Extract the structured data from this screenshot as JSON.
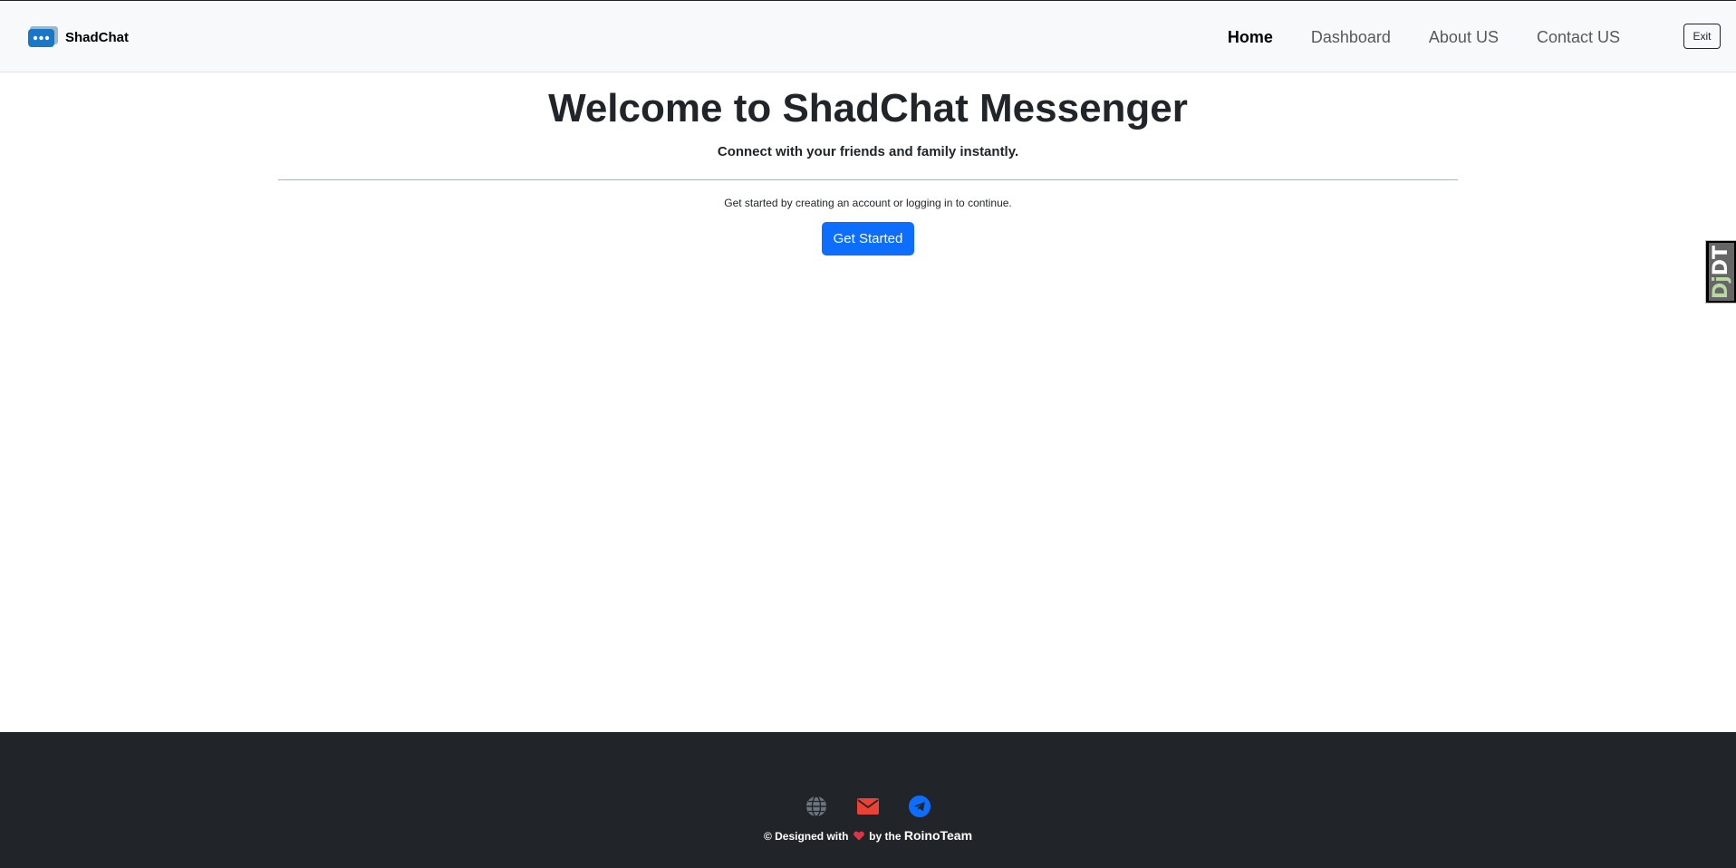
{
  "navbar": {
    "brand": {
      "name": "ShadChat",
      "logo_icon": "chat-bubble-icon"
    },
    "links": [
      {
        "label": "Home",
        "active": true
      },
      {
        "label": "Dashboard",
        "active": false
      },
      {
        "label": "About US",
        "active": false
      },
      {
        "label": "Contact US",
        "active": false
      }
    ],
    "exit_label": "Exit"
  },
  "hero": {
    "title": "Welcome to ShadChat Messenger",
    "subtitle": "Connect with your friends and family instantly.",
    "text": "Get started by creating an account or logging in to continue.",
    "cta_label": "Get Started"
  },
  "debug_toolbar": {
    "prefix": "Dj",
    "suffix": "DT"
  },
  "footer": {
    "icons": [
      "globe-icon",
      "envelope-icon",
      "telegram-icon"
    ],
    "credit_prefix": "© Designed with",
    "credit_middle": "by the",
    "team": "RoinoTeam"
  },
  "colors": {
    "primary": "#0d6efd",
    "navbar_bg": "#f8f9fa",
    "footer_bg": "#212529",
    "heart": "#dc3545",
    "envelope": "#ea4335",
    "telegram": "#0d6efd",
    "globe": "#6c757d"
  }
}
